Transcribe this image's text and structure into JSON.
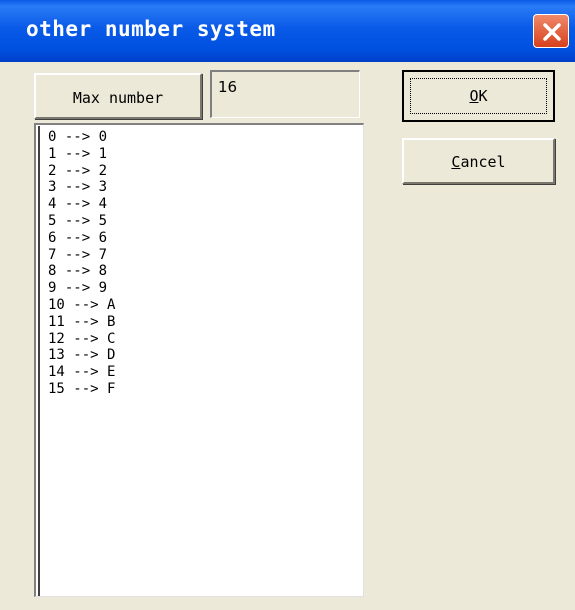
{
  "window": {
    "title": "other number system"
  },
  "controls": {
    "max_button_label": "Max number",
    "max_value": "16",
    "ok_label": "OK",
    "ok_mnemonic": "O",
    "ok_rest": "K",
    "cancel_label": "Cancel",
    "cancel_mnemonic": "C",
    "cancel_rest": "ancel"
  },
  "list": {
    "items": [
      "0 --> 0",
      "1 --> 1",
      "2 --> 2",
      "3 --> 3",
      "4 --> 4",
      "5 --> 5",
      "6 --> 6",
      "7 --> 7",
      "8 --> 8",
      "9 --> 9",
      "10 --> A",
      "11 --> B",
      "12 --> C",
      "13 --> D",
      "14 --> E",
      "15 --> F"
    ]
  },
  "colors": {
    "titlebar": "#0a5ae8",
    "face": "#ece9d8",
    "close": "#d8401c"
  },
  "icons": {
    "close": "close-icon"
  }
}
